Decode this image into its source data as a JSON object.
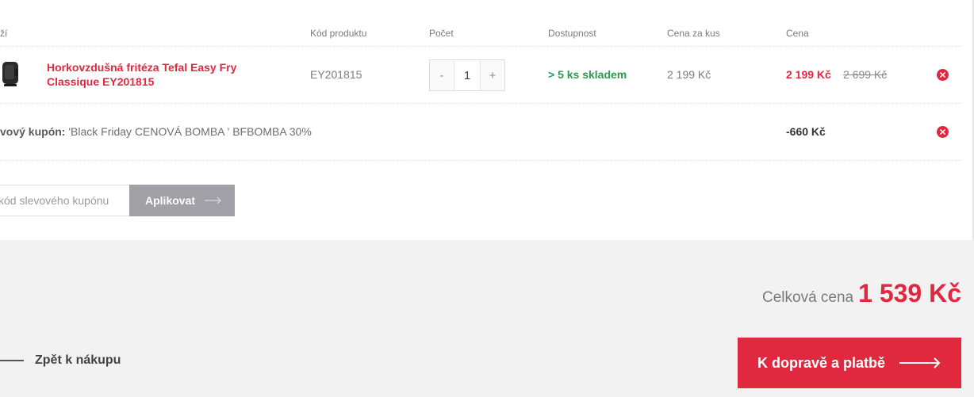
{
  "table": {
    "headers": {
      "product": "ží",
      "code": "Kód produktu",
      "qty": "Počet",
      "availability": "Dostupnost",
      "unit_price": "Cena za kus",
      "price": "Cena"
    }
  },
  "item": {
    "name": "Horkovzdušná fritéza Tefal Easy Fry Classique EY201815",
    "code": "EY201815",
    "qty_minus": "-",
    "qty": "1",
    "qty_plus": "+",
    "availability": "> 5 ks skladem",
    "unit_price": "2 199 Kč",
    "price": "2 199 Kč",
    "old_price": "2 699 Kč"
  },
  "coupon": {
    "label": "vový kupón:",
    "text": " 'Black Friday CENOVÁ BOMBA ' BFBOMBA 30%",
    "discount": "-660 Kč",
    "input_placeholder": "kód slevového kupónu",
    "apply_label": "Aplikovat"
  },
  "summary": {
    "total_label": "Celková cena",
    "total_value": "1 539 Kč"
  },
  "actions": {
    "back_label": "Zpět k nákupu",
    "checkout_label": "K dopravě a platbě"
  },
  "colors": {
    "accent": "#e0283f",
    "in_stock": "#2b9a50",
    "apply_button": "#a0a0a6",
    "page_bg": "#f2f2f2"
  }
}
